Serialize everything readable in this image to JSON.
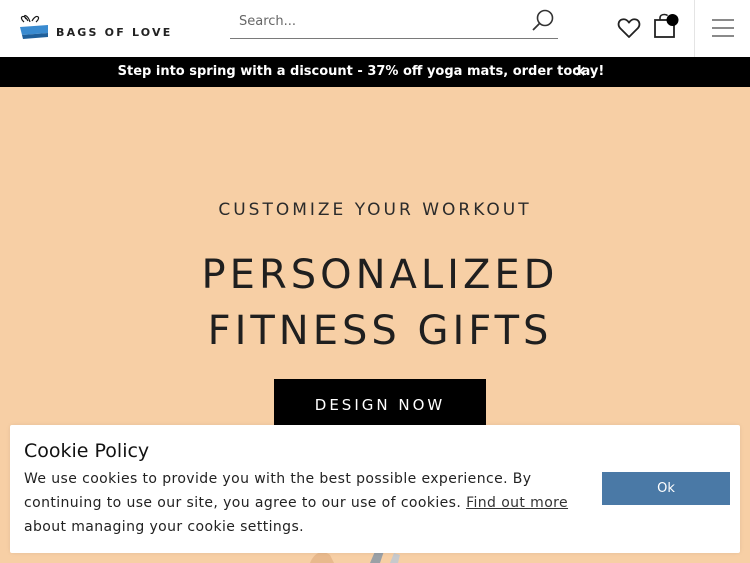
{
  "header": {
    "logo_text": "BAGS OF LOVE",
    "search_placeholder": "Search...",
    "icons": [
      "logo-icon",
      "search-icon",
      "heart-icon",
      "shopping-bag-icon",
      "menu-icon"
    ]
  },
  "promo": {
    "text": "Step into spring with a discount - 37% off yoga mats, order today!",
    "close_label": "×"
  },
  "hero": {
    "kicker": "CUSTOMIZE YOUR WORKOUT",
    "title_line1": "PERSONALIZED",
    "title_line2": "FITNESS GIFTS",
    "cta_label": "DESIGN NOW",
    "background_color": "#f7cfa5"
  },
  "cookie": {
    "title": "Cookie Policy",
    "text_before": "We use cookies to provide you with the best possible experience. By continuing to use our site, you agree to our use of cookies. ",
    "link_text": "Find out more",
    "text_after": " about managing your cookie settings.",
    "ok_label": "Ok",
    "ok_color": "#4a79a6"
  }
}
